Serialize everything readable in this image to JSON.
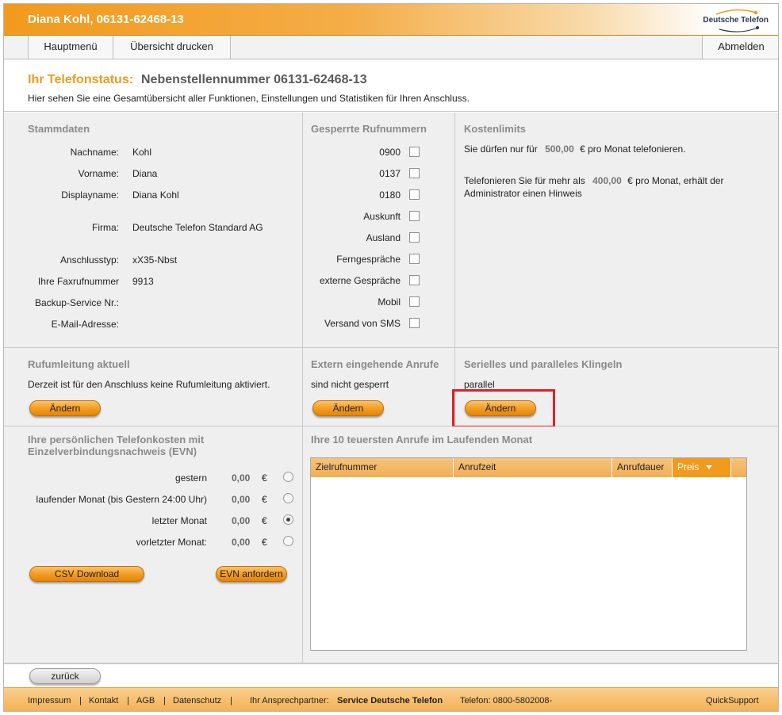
{
  "header": {
    "user_title": "Diana Kohl, 06131-62468-13",
    "logo_text": "Deutsche Telefon"
  },
  "menu": {
    "main_menu": "Hauptmenü",
    "print_overview": "Übersicht drucken",
    "logout": "Abmelden"
  },
  "title": {
    "label": "Ihr Telefonstatus:",
    "extension": "Nebenstellennummer 06131-62468-13",
    "description": "Hier sehen Sie eine Gesamtübersicht aller Funktionen, Einstellungen und Statistiken für Ihren Anschluss."
  },
  "stammdaten": {
    "title": "Stammdaten",
    "rows": [
      {
        "label": "Nachname:",
        "value": "Kohl"
      },
      {
        "label": "Vorname:",
        "value": "Diana"
      },
      {
        "label": "Displayname:",
        "value": "Diana Kohl"
      },
      {
        "label": "Firma:",
        "value": "Deutsche Telefon Standard AG"
      },
      {
        "label": "Anschlusstyp:",
        "value": "xX35-Nbst"
      },
      {
        "label": "Ihre Faxrufnummer",
        "value": "9913"
      },
      {
        "label": "Backup-Service Nr.:",
        "value": ""
      },
      {
        "label": "E-Mail-Adresse:",
        "value": ""
      }
    ]
  },
  "gesperrt": {
    "title": "Gesperrte Rufnummern",
    "items": [
      "0900",
      "0137",
      "0180",
      "Auskunft",
      "Ausland",
      "Ferngespräche",
      "externe Gespräche",
      "Mobil",
      "Versand von SMS"
    ]
  },
  "kosten": {
    "title": "Kostenlimits",
    "line1_pre": "Sie dürfen nur für",
    "line1_amount": "500,00",
    "line1_post": "€ pro Monat telefonieren.",
    "line2_pre": "Telefonieren Sie für mehr als",
    "line2_amount": "400,00",
    "line2_post": "€ pro Monat, erhält der",
    "line2_cont": "Administrator einen Hinweis"
  },
  "rufumleitung": {
    "title": "Rufumleitung aktuell",
    "text": "Derzeit ist für den Anschluss keine Rufumleitung aktiviert.",
    "button": "Ändern"
  },
  "extern": {
    "title": "Extern eingehende Anrufe",
    "text": "sind nicht gesperrt",
    "button": "Ändern"
  },
  "klingeln": {
    "title": "Serielles und paralleles Klingeln",
    "text": "parallel",
    "button": "Ändern"
  },
  "evn": {
    "title_line1": "Ihre persönlichen Telefonkosten mit",
    "title_line2": "Einzelverbindungsnachweis (EVN)",
    "rows": [
      {
        "label": "gestern",
        "amount": "0,00",
        "currency": "€",
        "selected": false
      },
      {
        "label": "laufender Monat (bis Gestern 24:00 Uhr)",
        "amount": "0,00",
        "currency": "€",
        "selected": false
      },
      {
        "label": "letzter Monat",
        "amount": "0,00",
        "currency": "€",
        "selected": true
      },
      {
        "label": "vorletzter Monat:",
        "amount": "0,00",
        "currency": "€",
        "selected": false
      }
    ],
    "csv_button": "CSV Download",
    "evn_button": "EVN anfordern"
  },
  "top10": {
    "title": "Ihre 10 teuersten Anrufe im Laufenden Monat",
    "columns": [
      "Zielrufnummer",
      "Anrufzeit",
      "Anrufdauer",
      "Preis"
    ],
    "rows": []
  },
  "back_button": "zurück",
  "footer": {
    "links": [
      "Impressum",
      "Kontakt",
      "AGB",
      "Datenschutz"
    ],
    "separator": "|",
    "contact_label": "Ihr Ansprechpartner:",
    "contact_name": "Service Deutsche Telefon",
    "phone": "Telefon: 0800-5802008-",
    "quicksupport": "QuickSupport"
  },
  "colors": {
    "accent": "#f29a1c",
    "highlight": "#e0202a",
    "panel": "#efefef"
  }
}
